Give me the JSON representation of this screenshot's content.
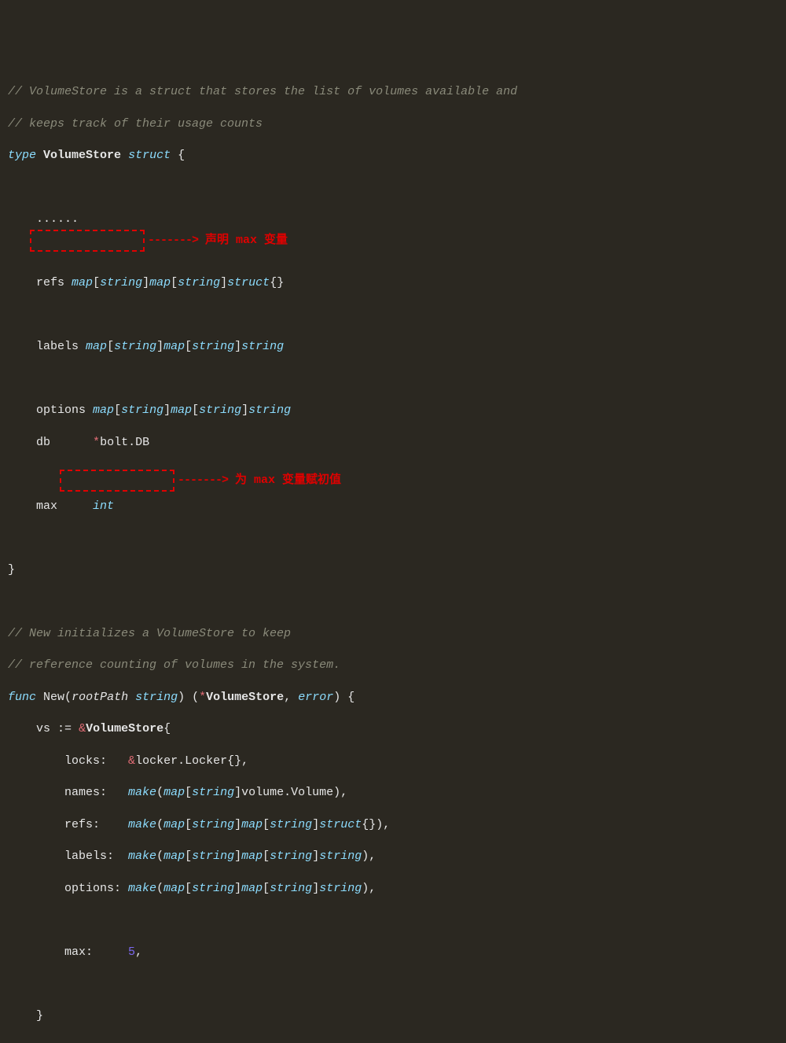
{
  "comment1": "// VolumeStore is a struct that stores the list of volumes available and",
  "comment2": "// keeps track of their usage counts",
  "kw_type": "type",
  "type_name": "VolumeStore",
  "kw_struct": "struct",
  "brace_open": "{",
  "dots": "......",
  "refs_field": "refs",
  "map_kw": "map",
  "string_type": "string",
  "struct_type": "struct",
  "empty_braces": "{}",
  "labels_field": "labels",
  "options_field": "options",
  "db_field": "db",
  "bolt_db": "bolt.DB",
  "max_field": "max",
  "int_type": "int",
  "brace_close": "}",
  "annotation1_arrow": "------->",
  "annotation1_text": "声明 max 变量",
  "comment3": "// New initializes a VolumeStore to keep",
  "comment4": "// reference counting of volumes in the system.",
  "kw_func": "func",
  "func_new": "New",
  "param_rootpath": "rootPath",
  "error_type": "error",
  "paren_open": "(",
  "paren_close": ")",
  "vs_var": "vs",
  "assign_op": ":=",
  "amp_sym": "&",
  "star_sym": "*",
  "locks_field": "locks:",
  "locker_locker": "locker.Locker{}",
  "names_field": "names:",
  "make_fn": "make",
  "volume_volume": "volume.Volume",
  "refs_field2": "refs:",
  "labels_field2": "labels:",
  "options_field2": "options:",
  "max_field2": "max:",
  "max_value": "5",
  "comma": ",",
  "annotation2_arrow": "------->",
  "annotation2_text": "为 max 变量赋初值",
  "bracket_open": "[",
  "bracket_close": "]"
}
